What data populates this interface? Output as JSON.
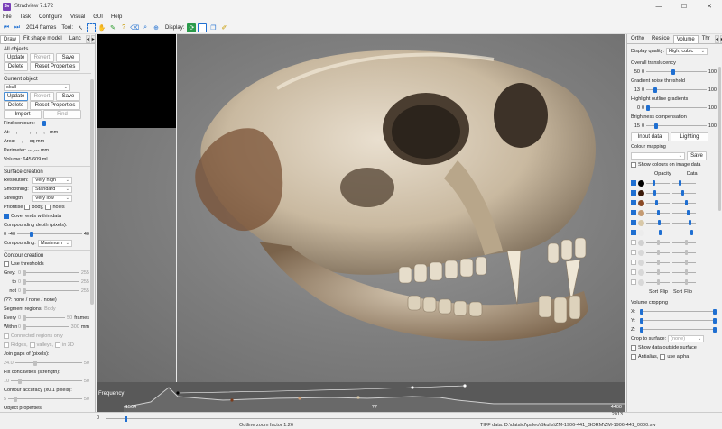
{
  "window": {
    "app_icon_label": "Sv",
    "title": "Stradview 7.172",
    "minimize": "—",
    "maximize": "☐",
    "close": "✕"
  },
  "menu": [
    "File",
    "Task",
    "Configure",
    "Visual",
    "GUI",
    "Help"
  ],
  "toolbar": {
    "frames": "2014 frames",
    "tool_label": "Tool:",
    "display_label": "Display:"
  },
  "left": {
    "tabs": [
      "Draw",
      "Fit shape model",
      "Lanc"
    ],
    "all_objects": {
      "title": "All objects",
      "update": "Update",
      "revert": "Revert",
      "save": "Save",
      "delete": "Delete",
      "reset": "Reset Properties"
    },
    "current_object": {
      "title": "Current object",
      "object_value": "skull",
      "update": "Update",
      "revert": "Revert",
      "save": "Save",
      "delete": "Delete",
      "reset": "Reset Properties",
      "import": "Import",
      "find": "Find",
      "find_contours": "Find contours:",
      "at": "At: ---,-- , ---,-- , ---,-- mm",
      "area": "Area: ---,--- sq mm",
      "perimeter": "Perimeter: ---,--- mm",
      "volume": "Volume: 645.609 ml"
    },
    "surface": {
      "title": "Surface creation",
      "resolution_label": "Resolution:",
      "resolution_value": "Very high",
      "smoothing_label": "Smoothing:",
      "smoothing_value": "Standard",
      "strength_label": "Strength:",
      "strength_value": "Very low",
      "prioritise_label": "Prioritise",
      "body_label": "body,",
      "holes_label": "holes",
      "cover_ends": "Cover ends within data",
      "comp_depth": "Compounding depth (pixels):",
      "comp_min": "0",
      "comp_val": "-40",
      "comp_max": "40",
      "compounding_label": "Compounding:",
      "compounding_value": "Maximum"
    },
    "contour": {
      "title": "Contour creation",
      "use_thresholds": "Use thresholds",
      "grey": "Grey:",
      "grey_min": "0",
      "grey_max": "255",
      "to": "to",
      "to_min": "0",
      "to_max": "255",
      "not": "not",
      "not_min": "0",
      "not_max": "255",
      "status": "(??: none / none / none)",
      "segment_regions": "Segment regions:",
      "segment_value": "Body",
      "every": "Every",
      "every_min": "0",
      "every_max": "50",
      "every_unit": "frames",
      "within": "Within",
      "within_min": "0",
      "within_max": "300",
      "within_unit": "mm",
      "connected": "Connected regions only",
      "ridges": "Ridges,",
      "valleys": "valleys,",
      "in3d": "in 3D",
      "join_gaps": "Join gaps of (pixels):",
      "join_min": "24.0",
      "join_max": "50",
      "fix_concav": "Fix concavities (strength):",
      "fix_min": "10",
      "fix_max": "50",
      "contour_acc": "Contour accuracy (x0.1 pixels):",
      "acc_min": "5",
      "acc_max": "50",
      "object_properties": "Object properties"
    }
  },
  "viewport": {
    "histogram_label": "Frequency",
    "hist_min": "-1564",
    "hist_mid": "??",
    "hist_max": "4400"
  },
  "statusbar": {
    "frame_start": "0",
    "frame_end": "2013",
    "zoom": "Outline zoom factor 1.26",
    "tiff": "TIFF data: D:\\data\\cf\\paleo\\Skulls\\ZM-1906-441_GORM\\ZM-1906-441_0000.sw"
  },
  "right": {
    "tabs": [
      "Ortho",
      "Reslice",
      "Volume",
      "Thr"
    ],
    "display_quality_label": "Display quality:",
    "display_quality_value": "High, cubic",
    "overall_translucency": "Overall translucency",
    "ot_val": "50",
    "ot_min": "0",
    "ot_max": "100",
    "gradient_noise": "Gradient noise threshold",
    "gn_val": "13",
    "gn_min": "0",
    "gn_max": "100",
    "highlight_outline": "Highlight outline gradients",
    "ho_val": "0",
    "ho_min": "0",
    "ho_max": "100",
    "brightness": "Brightness compensation",
    "br_val": "15",
    "br_min": "0",
    "br_max": "100",
    "input_data": "Input data",
    "lighting": "Lighting",
    "colour_mapping": "Colour mapping",
    "save": "Save",
    "show_colours": "Show colours on image data",
    "opacity": "Opacity",
    "data": "Data",
    "sort": "Sort",
    "flip": "Flip",
    "sort2": "Sort",
    "flip2": "Flip",
    "volume_cropping": "Volume cropping",
    "x": "X:",
    "y": "Y:",
    "z": "Z:",
    "crop_to_surface": "Crop to surface:",
    "crop_value": "(none)",
    "show_outside": "Show data outside surface",
    "antialias": "Antialias,",
    "use_alpha": "use alpha",
    "swatches": [
      "#000000",
      "#3a1a0a",
      "#8a4a26",
      "#c49a72",
      "#d8c8a8",
      "#ececec",
      "#bcbcbc",
      "#c8c8c8",
      "#c8c8c8",
      "#c8c8c8",
      "#c8c8c8"
    ]
  }
}
